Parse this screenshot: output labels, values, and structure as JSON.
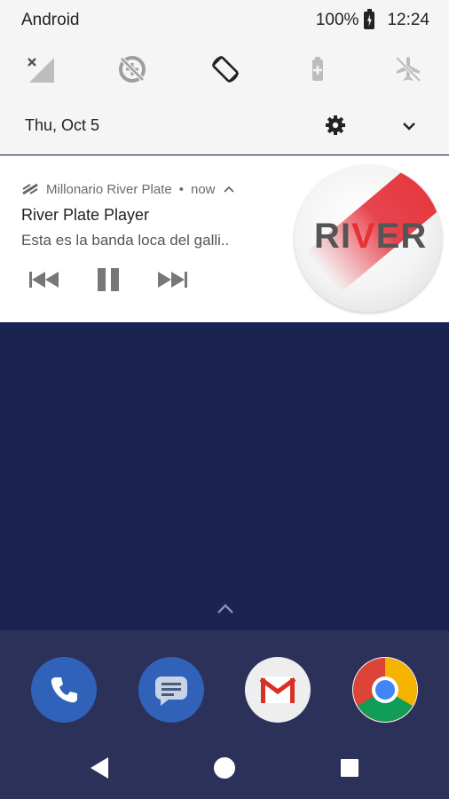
{
  "status_bar": {
    "carrier": "Android",
    "battery": "100%",
    "time": "12:24"
  },
  "quick_settings": {
    "tiles": [
      "signal-off-icon",
      "data-saver-off-icon",
      "auto-rotate-icon",
      "battery-saver-icon",
      "airplane-mode-icon"
    ],
    "date": "Thu, Oct 5"
  },
  "notification": {
    "app_name": "Millonario River Plate",
    "time": "now",
    "title": "River Plate Player",
    "text": "Esta es la banda loca del galli..",
    "art_text_before": "RI",
    "art_text_highlight": "V",
    "art_text_after": "ER",
    "controls": [
      "previous-icon",
      "pause-icon",
      "next-icon"
    ]
  },
  "dock": {
    "apps": [
      "phone-icon",
      "messages-icon",
      "gmail-icon",
      "chrome-icon"
    ]
  },
  "colors": {
    "wallpaper": "#1b2350",
    "accent_red": "#e53238"
  }
}
